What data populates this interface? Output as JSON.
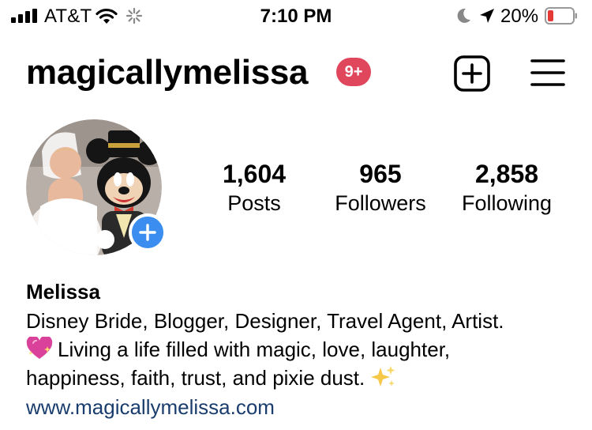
{
  "status_bar": {
    "carrier": "AT&T",
    "time": "7:10 PM",
    "battery_percent": "20%",
    "icons": [
      "signal-bars-icon",
      "wifi-icon",
      "activity-spinner-icon",
      "moon-icon",
      "location-arrow-icon",
      "battery-low-icon"
    ],
    "battery_color": "#e53935"
  },
  "header": {
    "username": "magicallymelissa",
    "notification_badge": "9+",
    "badge_color": "#e0465c",
    "new_post_icon": "plus-square-icon",
    "menu_icon": "hamburger-menu-icon"
  },
  "profile": {
    "avatar_icon": "profile-photo",
    "add_story_icon": "plus-icon",
    "add_story_color": "#3b8ef0",
    "stats": [
      {
        "value": "1,604",
        "label": "Posts"
      },
      {
        "value": "965",
        "label": "Followers"
      },
      {
        "value": "2,858",
        "label": "Following"
      }
    ]
  },
  "bio": {
    "name": "Melissa",
    "line1": "Disney Bride, Blogger, Designer, Travel Agent, Artist.",
    "line2": "Living a life filled with magic, love, laughter,",
    "line3": "happiness, faith, trust, and pixie dust.",
    "emoji_heart": "sparkling-heart-icon",
    "emoji_sparkles": "sparkles-icon",
    "website": "www.magicallymelissa.com",
    "link_color": "#1a3d6d"
  }
}
